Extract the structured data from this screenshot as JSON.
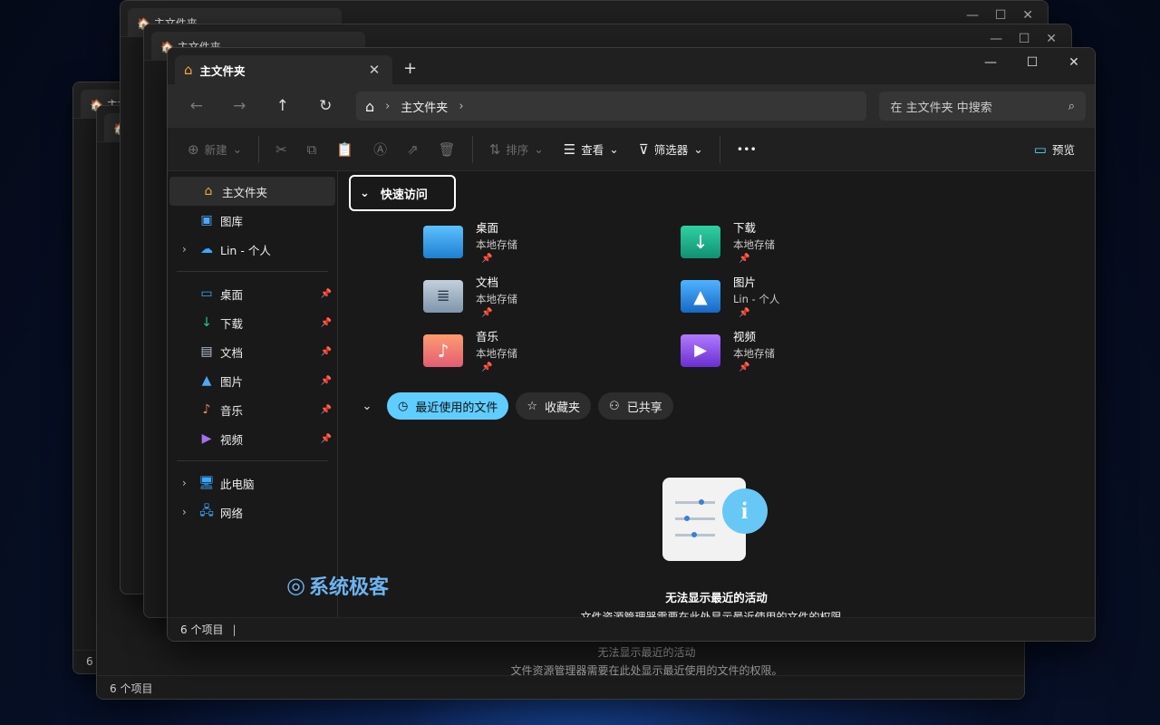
{
  "window": {
    "tab_title": "主文件夹",
    "close_tab": "✕",
    "new_tab": "+",
    "minimize": "—",
    "maximize": "☐",
    "close": "✕"
  },
  "nav": {
    "back": "←",
    "forward": "→",
    "up": "↑",
    "refresh": "↻",
    "breadcrumb": [
      "主文件夹"
    ],
    "search_placeholder": "在 主文件夹 中搜索"
  },
  "toolbar": {
    "new_label": "新建",
    "sort_label": "排序",
    "view_label": "查看",
    "filter_label": "筛选器",
    "more_label": "•••",
    "preview_label": "预览"
  },
  "sidebar": {
    "top": [
      {
        "label": "主文件夹",
        "icon": "home-icon"
      },
      {
        "label": "图库",
        "icon": "gallery-icon"
      },
      {
        "label": "Lin - 个人",
        "icon": "onedrive-icon"
      }
    ],
    "pinned": [
      {
        "label": "桌面",
        "icon": "desktop-icon"
      },
      {
        "label": "下载",
        "icon": "download-icon"
      },
      {
        "label": "文档",
        "icon": "documents-icon"
      },
      {
        "label": "图片",
        "icon": "pictures-icon"
      },
      {
        "label": "音乐",
        "icon": "music-icon"
      },
      {
        "label": "视频",
        "icon": "videos-icon"
      }
    ],
    "bottom": [
      {
        "label": "此电脑",
        "icon": "computer-icon"
      },
      {
        "label": "网络",
        "icon": "network-icon"
      }
    ]
  },
  "quick_access": {
    "title": "快速访问",
    "folders": [
      {
        "name": "桌面",
        "sub": "本地存储",
        "color": "#2f9ee8"
      },
      {
        "name": "下载",
        "sub": "本地存储",
        "color": "#1fae8c"
      },
      {
        "name": "文档",
        "sub": "本地存储",
        "color": "#8fa3b8"
      },
      {
        "name": "图片",
        "sub": "Lin - 个人",
        "color": "#2c8fe0"
      },
      {
        "name": "音乐",
        "sub": "本地存储",
        "color": "#f08860"
      },
      {
        "name": "视频",
        "sub": "本地存储",
        "color": "#8a4fd8"
      }
    ]
  },
  "recent": {
    "tabs": [
      "最近使用的文件",
      "收藏夹",
      "已共享"
    ],
    "empty_title": "无法显示最近的活动",
    "empty_sub": "文件资源管理器需要在此处显示最近使用的文件的权限。"
  },
  "status": {
    "items": "6 个项目"
  },
  "watermark": "系统极客",
  "background_windows": {
    "tab_title": "主文件夹",
    "status_items": "6 个项目",
    "empty_title": "无法显示最近的活动",
    "empty_sub": "文件资源管理器需要在此处显示最近使用的文件的权限。",
    "side_item_count": "6"
  },
  "colors": {
    "accent": "#60cdff"
  }
}
